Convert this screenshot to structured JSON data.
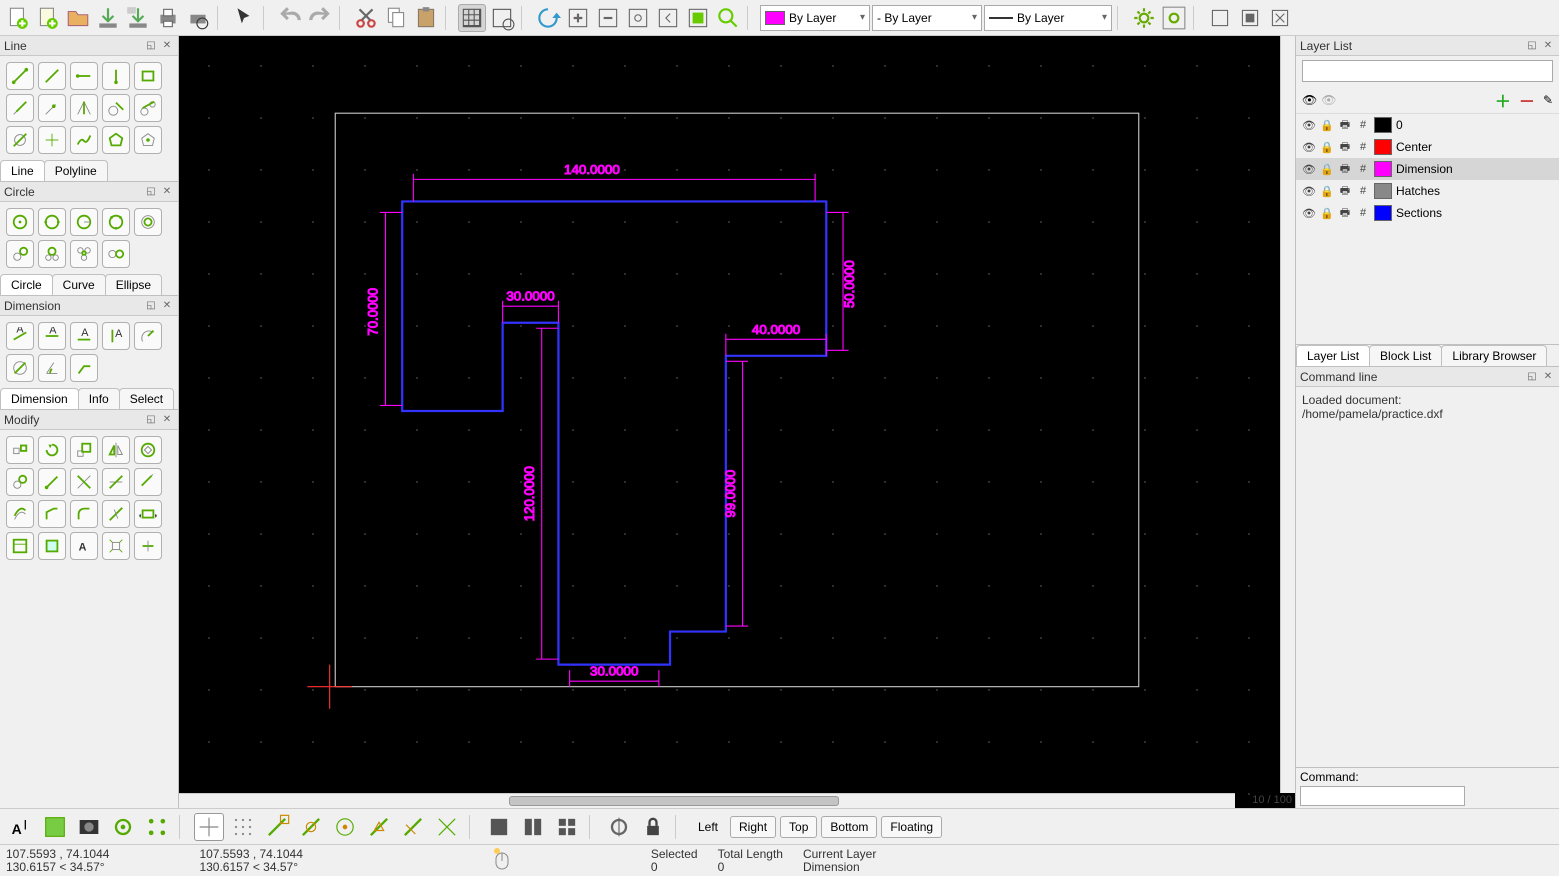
{
  "toolbar_top": {
    "color_combo": "By Layer",
    "width_combo": "- By Layer",
    "linetype_combo": "By Layer"
  },
  "left_panels": {
    "line": {
      "title": "Line",
      "tabs": [
        "Line",
        "Polyline"
      ],
      "active_tab": 0
    },
    "circle": {
      "title": "Circle",
      "tabs": [
        "Circle",
        "Curve",
        "Ellipse"
      ],
      "active_tab": 0
    },
    "dimension": {
      "title": "Dimension",
      "tabs": [
        "Dimension",
        "Info",
        "Select"
      ],
      "active_tab": 0
    },
    "modify": {
      "title": "Modify"
    }
  },
  "layer_panel": {
    "title": "Layer List",
    "tabs": [
      "Layer List",
      "Block List",
      "Library Browser"
    ],
    "active_tab": 0,
    "layers": [
      {
        "name": "0",
        "color": "#000000",
        "selected": false
      },
      {
        "name": "Center",
        "color": "#ff0000",
        "selected": false
      },
      {
        "name": "Dimension",
        "color": "#ff00ff",
        "selected": true
      },
      {
        "name": "Hatches",
        "color": "#888888",
        "selected": false
      },
      {
        "name": "Sections",
        "color": "#0000ff",
        "selected": false
      }
    ]
  },
  "command_line": {
    "title": "Command line",
    "log": "Loaded document:\n/home/pamela/practice.dxf",
    "prompt": "Command:"
  },
  "canvas": {
    "zoom": "10 / 100",
    "dimensions": {
      "top": "140.0000",
      "d30_upper": "30.0000",
      "d40": "40.0000",
      "d50": "50.0000",
      "d70": "70.0000",
      "d120": "120.0000",
      "d99": "99.0000",
      "d30_lower": "30.0000"
    }
  },
  "dock_buttons": [
    "Left",
    "Right",
    "Top",
    "Bottom",
    "Floating"
  ],
  "status": {
    "abs_coord": "107.5593 , 74.1044",
    "rel_coord": "130.6157 < 34.57°",
    "abs_coord2": "107.5593 , 74.1044",
    "rel_coord2": "130.6157 < 34.57°",
    "selected_label": "Selected",
    "selected_val": "0",
    "total_label": "Total Length",
    "total_val": "0",
    "layer_label": "Current Layer",
    "layer_val": "Dimension"
  }
}
